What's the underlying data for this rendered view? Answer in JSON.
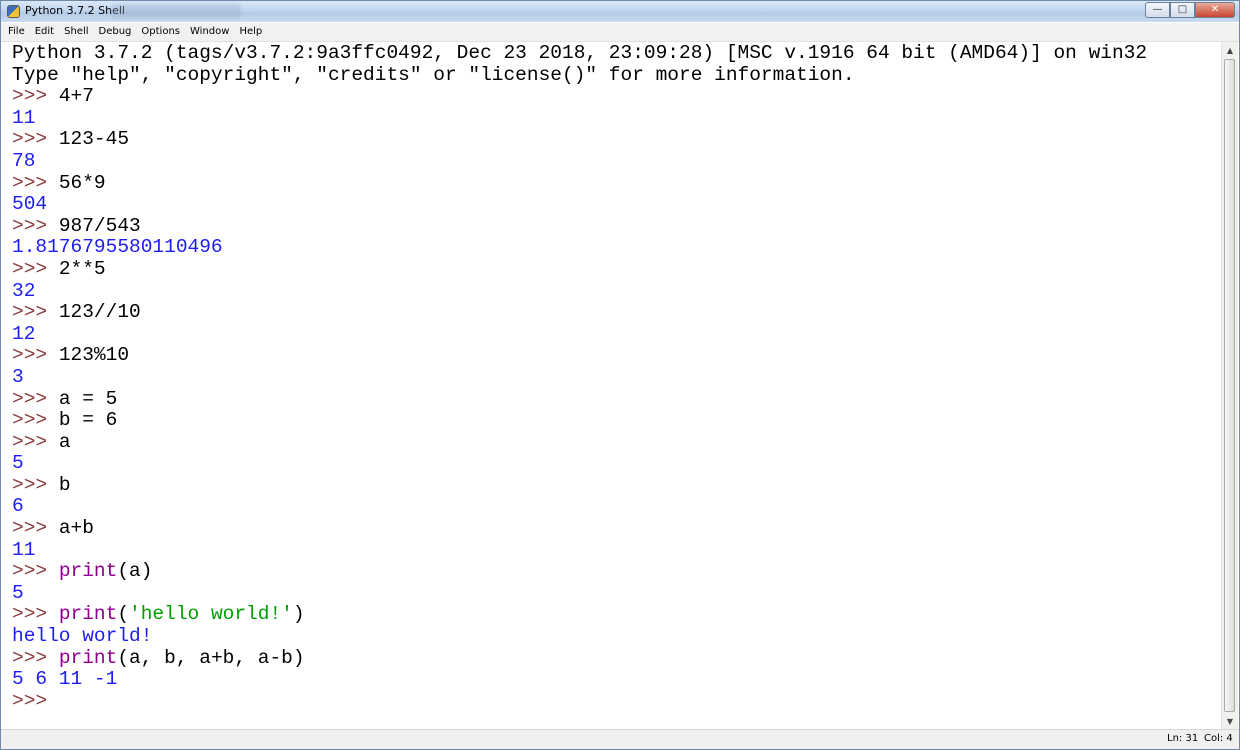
{
  "window": {
    "title": "Python 3.7.2 Shell",
    "minimize_glyph": "—",
    "maximize_glyph": "□",
    "close_glyph": "✕"
  },
  "menu": [
    "File",
    "Edit",
    "Shell",
    "Debug",
    "Options",
    "Window",
    "Help"
  ],
  "shell_lines": [
    {
      "type": "banner",
      "text": "Python 3.7.2 (tags/v3.7.2:9a3ffc0492, Dec 23 2018, 23:09:28) [MSC v.1916 64 bit (AMD64)] on win32"
    },
    {
      "type": "banner",
      "text": "Type \"help\", \"copyright\", \"credits\" or \"license()\" for more information."
    },
    {
      "type": "input",
      "prompt": ">>> ",
      "parts": [
        {
          "style": "input",
          "text": "4+7"
        }
      ]
    },
    {
      "type": "output",
      "text": "11"
    },
    {
      "type": "input",
      "prompt": ">>> ",
      "parts": [
        {
          "style": "input",
          "text": "123-45"
        }
      ]
    },
    {
      "type": "output",
      "text": "78"
    },
    {
      "type": "input",
      "prompt": ">>> ",
      "parts": [
        {
          "style": "input",
          "text": "56*9"
        }
      ]
    },
    {
      "type": "output",
      "text": "504"
    },
    {
      "type": "input",
      "prompt": ">>> ",
      "parts": [
        {
          "style": "input",
          "text": "987/543"
        }
      ]
    },
    {
      "type": "output",
      "text": "1.8176795580110496"
    },
    {
      "type": "input",
      "prompt": ">>> ",
      "parts": [
        {
          "style": "input",
          "text": "2**5"
        }
      ]
    },
    {
      "type": "output",
      "text": "32"
    },
    {
      "type": "input",
      "prompt": ">>> ",
      "parts": [
        {
          "style": "input",
          "text": "123//10"
        }
      ]
    },
    {
      "type": "output",
      "text": "12"
    },
    {
      "type": "input",
      "prompt": ">>> ",
      "parts": [
        {
          "style": "input",
          "text": "123%10"
        }
      ]
    },
    {
      "type": "output",
      "text": "3"
    },
    {
      "type": "input",
      "prompt": ">>> ",
      "parts": [
        {
          "style": "input",
          "text": "a = 5"
        }
      ]
    },
    {
      "type": "input",
      "prompt": ">>> ",
      "parts": [
        {
          "style": "input",
          "text": "b = 6"
        }
      ]
    },
    {
      "type": "input",
      "prompt": ">>> ",
      "parts": [
        {
          "style": "input",
          "text": "a"
        }
      ]
    },
    {
      "type": "output",
      "text": "5"
    },
    {
      "type": "input",
      "prompt": ">>> ",
      "parts": [
        {
          "style": "input",
          "text": "b"
        }
      ]
    },
    {
      "type": "output",
      "text": "6"
    },
    {
      "type": "input",
      "prompt": ">>> ",
      "parts": [
        {
          "style": "input",
          "text": "a+b"
        }
      ]
    },
    {
      "type": "output",
      "text": "11"
    },
    {
      "type": "input",
      "prompt": ">>> ",
      "parts": [
        {
          "style": "builtin",
          "text": "print"
        },
        {
          "style": "input",
          "text": "(a)"
        }
      ]
    },
    {
      "type": "output",
      "text": "5"
    },
    {
      "type": "input",
      "prompt": ">>> ",
      "parts": [
        {
          "style": "builtin",
          "text": "print"
        },
        {
          "style": "input",
          "text": "("
        },
        {
          "style": "string",
          "text": "'hello world!'"
        },
        {
          "style": "input",
          "text": ")"
        }
      ]
    },
    {
      "type": "output",
      "text": "hello world!"
    },
    {
      "type": "input",
      "prompt": ">>> ",
      "parts": [
        {
          "style": "builtin",
          "text": "print"
        },
        {
          "style": "input",
          "text": "(a, b, a+b, a-b)"
        }
      ]
    },
    {
      "type": "output",
      "text": "5 6 11 -1"
    },
    {
      "type": "input",
      "prompt": ">>> ",
      "parts": []
    }
  ],
  "status": {
    "ln": "Ln: 31",
    "col": "Col: 4"
  },
  "colors": {
    "prompt": "#8b3a3a",
    "output": "#1d1df0",
    "builtin": "#900090",
    "string": "#00a000"
  }
}
